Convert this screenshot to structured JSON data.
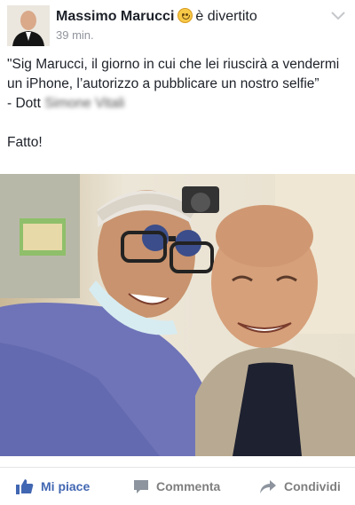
{
  "post": {
    "author": "Massimo Marucci",
    "activity": "è divertito",
    "timestamp": "39 min.",
    "text_line1": "\"Sig Marucci, il giorno in cui che lei riuscirà a vendermi un iPhone, l’autorizzo a pubblicare un nostro selfie”",
    "text_line2_prefix": "- Dott ",
    "text_line2_blurred": "Simone Vitali",
    "text_line3": "Fatto!"
  },
  "actions": {
    "like_label": "Mi piace",
    "comment_label": "Commenta",
    "share_label": "Condividi"
  },
  "colors": {
    "like_blue": "#4267b2",
    "grey": "#7f7f7f",
    "author_text": "#1d2129",
    "timestamp": "#90949c"
  },
  "icons": {
    "feeling": "smiling-face-icon",
    "menu": "chevron-down-icon",
    "like": "thumbs-up-icon",
    "comment": "comment-bubble-icon",
    "share": "share-arrow-icon"
  }
}
